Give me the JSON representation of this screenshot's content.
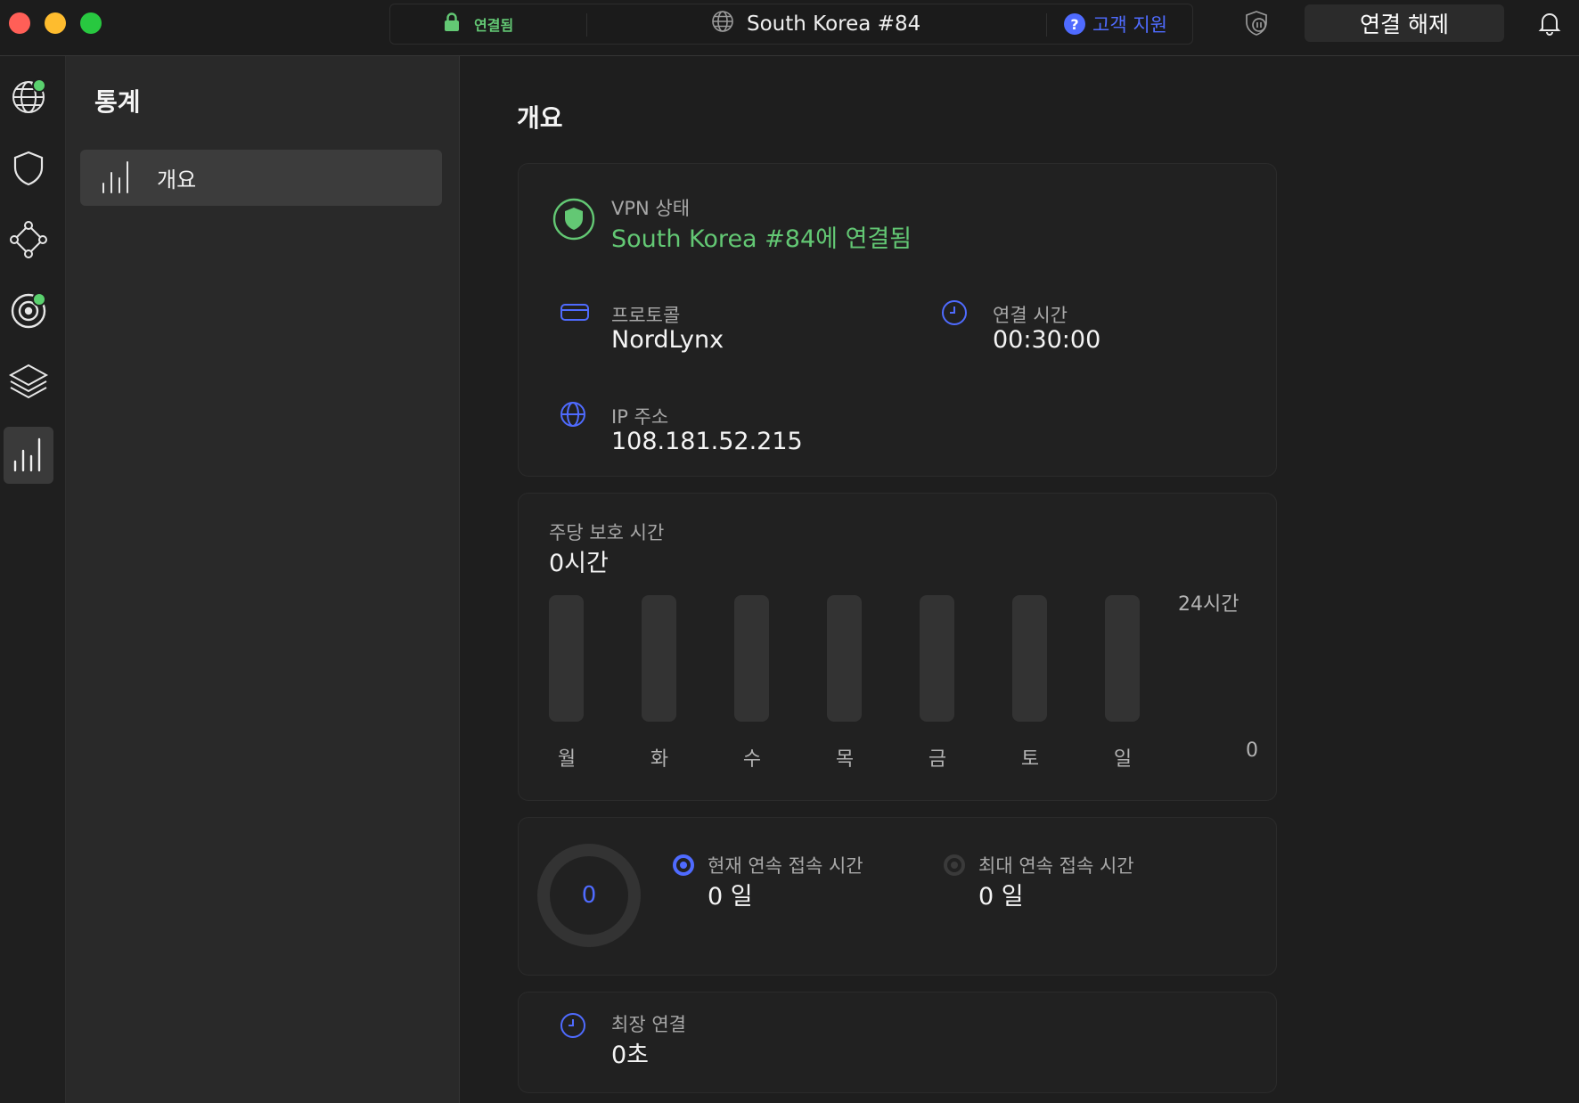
{
  "titlebar": {
    "status_label": "연결됨",
    "server_name": "South Korea #84",
    "help_label": "고객 지원",
    "help_symbol": "?",
    "disconnect_label": "연결 해제"
  },
  "rail": {
    "items": [
      {
        "icon": "globe-icon",
        "badge": true
      },
      {
        "icon": "shield-icon",
        "badge": false
      },
      {
        "icon": "meshnet-icon",
        "badge": false
      },
      {
        "icon": "target-icon",
        "badge": true
      },
      {
        "icon": "layers-icon",
        "badge": false
      },
      {
        "icon": "stats-icon",
        "badge": false,
        "active": true
      }
    ]
  },
  "sidebar": {
    "title": "통계",
    "items": [
      {
        "label": "개요",
        "icon": "bar-chart-icon",
        "active": true
      }
    ]
  },
  "main": {
    "title": "개요",
    "vpn": {
      "status_label": "VPN 상태",
      "status_value": "South Korea #84에 연결됨",
      "protocol_label": "프로토콜",
      "protocol_value": "NordLynx",
      "time_label": "연결 시간",
      "time_value": "00:30:00",
      "ip_label": "IP 주소",
      "ip_value": "108.181.52.215"
    },
    "weekly": {
      "label": "주당 보호 시간",
      "value": "0시간"
    },
    "streak": {
      "ring_value": "0",
      "current_label": "현재 연속 접속 시간",
      "current_value": "0 일",
      "max_label": "최대 연속 접속 시간",
      "max_value": "0 일"
    },
    "longest": {
      "label": "최장 연결",
      "value": "0초"
    }
  },
  "colors": {
    "accent_green": "#63c874",
    "accent_blue": "#4f6bff",
    "bar_empty": "#333333"
  },
  "chart_data": {
    "type": "bar",
    "categories": [
      "월",
      "화",
      "수",
      "목",
      "금",
      "토",
      "일"
    ],
    "values": [
      0,
      0,
      0,
      0,
      0,
      0,
      0
    ],
    "ylim": [
      0,
      24
    ],
    "y_tick_labels": [
      "24시간",
      "0"
    ]
  }
}
